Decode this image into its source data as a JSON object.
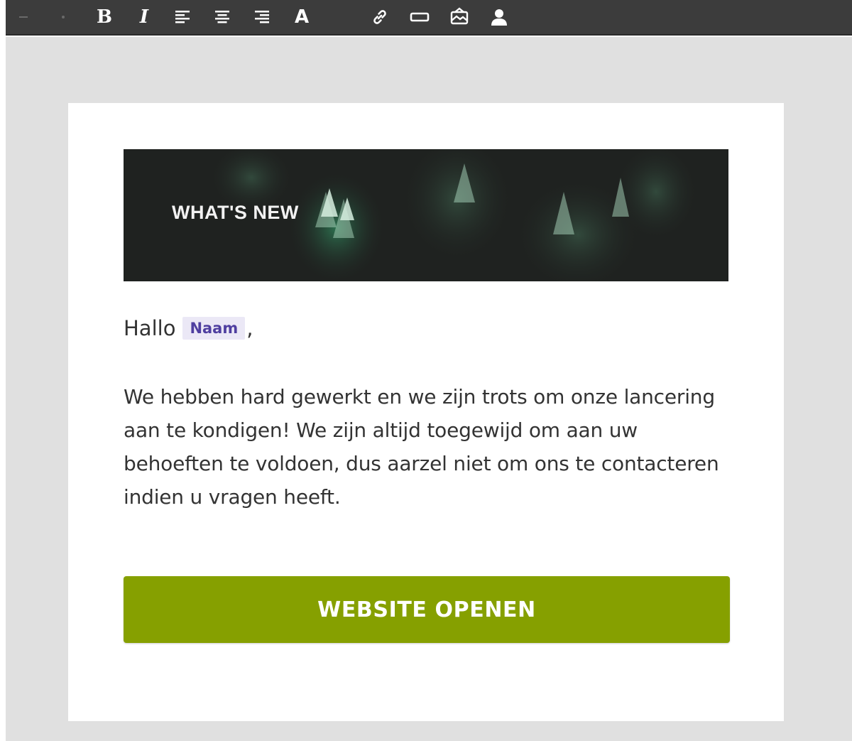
{
  "toolbar": {
    "buttons": [
      {
        "icon": "undo-icon",
        "enabled": false
      },
      {
        "icon": "redo-icon",
        "enabled": false
      },
      {
        "icon": "bold-icon",
        "glyph": "B"
      },
      {
        "icon": "italic-icon",
        "glyph": "I"
      },
      {
        "icon": "align-left-icon"
      },
      {
        "icon": "align-center-icon"
      },
      {
        "icon": "align-right-icon"
      },
      {
        "icon": "font-color-icon",
        "glyph": "A"
      },
      {
        "icon": "link-icon"
      },
      {
        "icon": "button-insert-icon"
      },
      {
        "icon": "image-insert-icon"
      },
      {
        "icon": "personalization-icon"
      }
    ]
  },
  "email": {
    "banner_title": "WHAT'S NEW",
    "greeting_word": "Hallo",
    "merge_tag": "Naam",
    "greeting_punct": ",",
    "body_text": "We hebben hard gewerkt en we zijn trots om onze lancering aan te kondigen! We zijn altijd toegewijd om aan uw behoeften te voldoen, dus aarzel niet om ons te contacteren indien u vragen heeft.",
    "cta_label": "WEBSITE OPENEN"
  },
  "colors": {
    "toolbar_bg": "#3c3c3c",
    "canvas_bg": "#e0e0e0",
    "cta_bg": "#86a000",
    "merge_tag_bg": "#ebe8f6",
    "merge_tag_text": "#4f3fa0",
    "banner_bg": "#1f2220"
  }
}
